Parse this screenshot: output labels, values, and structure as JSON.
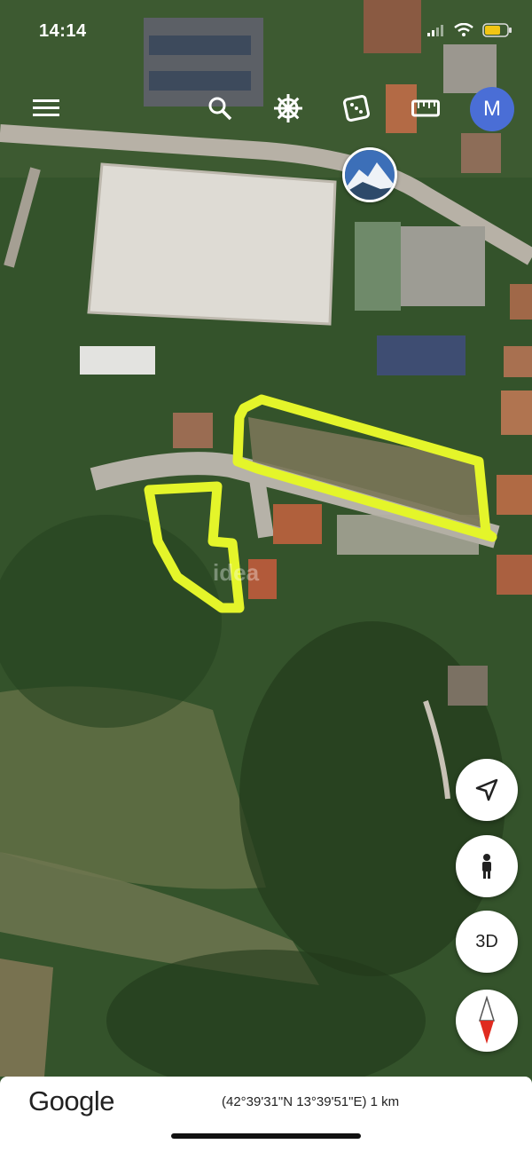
{
  "status_bar": {
    "time": "14:14"
  },
  "toolbar": {
    "menu_icon": "menu-icon",
    "search_icon": "search-icon",
    "voyager_icon": "ship-wheel-icon",
    "feeling_lucky_icon": "dice-icon",
    "measure_icon": "ruler-icon",
    "avatar_letter": "M"
  },
  "map": {
    "watermark": "idea",
    "highlight_color": "#e4f52a"
  },
  "controls": {
    "locate_icon": "navigation-arrow-icon",
    "streetview_icon": "pegman-icon",
    "three_d_label": "3D",
    "compass_icon": "compass-icon"
  },
  "bottom_bar": {
    "logo": "Google",
    "coordinates": "(42°39'31\"N 13°39'51\"E) 1 km"
  }
}
